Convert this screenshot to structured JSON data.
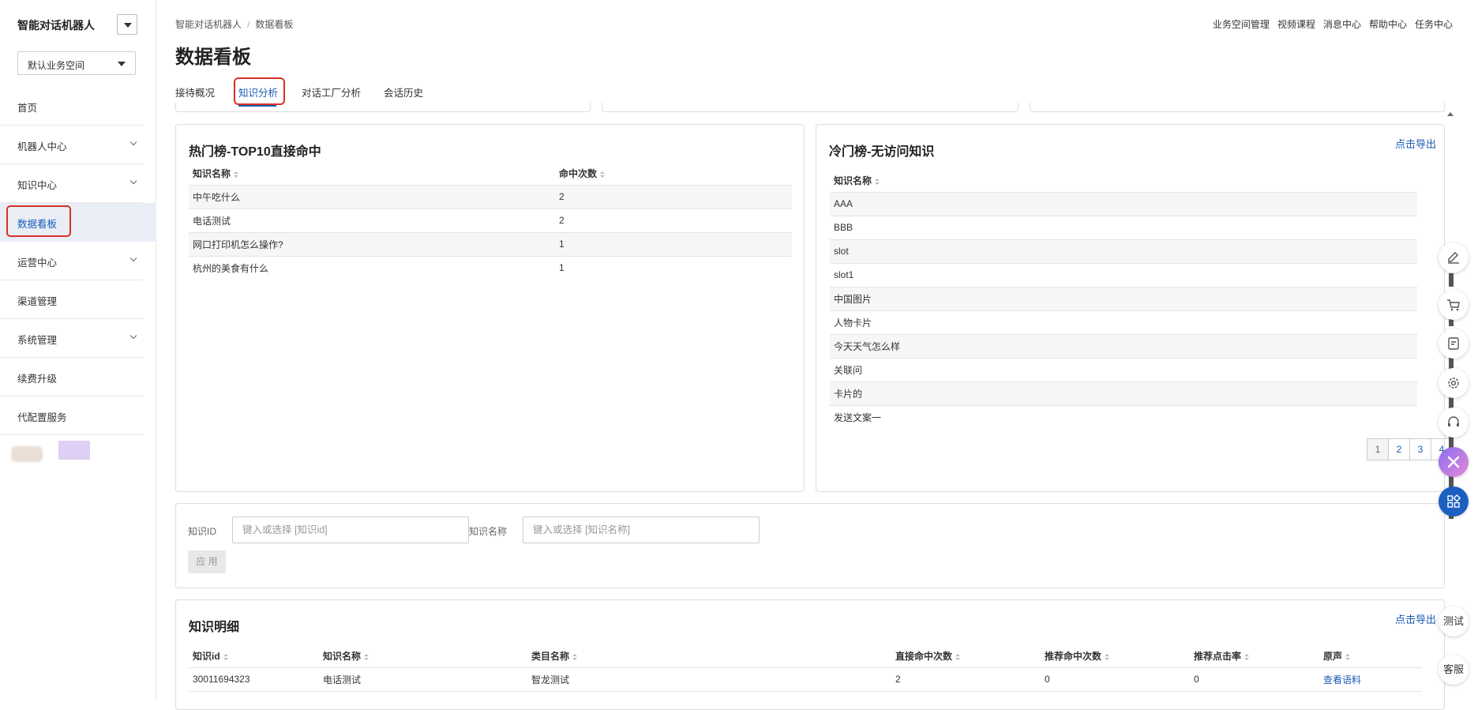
{
  "sidebar": {
    "brand": "智能对话机器人",
    "space_select": "默认业务空间",
    "items": [
      {
        "label": "首页",
        "has_chevron": false
      },
      {
        "label": "机器人中心",
        "has_chevron": true
      },
      {
        "label": "知识中心",
        "has_chevron": true
      },
      {
        "label": "数据看板",
        "has_chevron": false,
        "active": true
      },
      {
        "label": "运营中心",
        "has_chevron": true
      },
      {
        "label": "渠道管理",
        "has_chevron": false
      },
      {
        "label": "系统管理",
        "has_chevron": true
      },
      {
        "label": "续费升级",
        "has_chevron": false
      },
      {
        "label": "代配置服务",
        "has_chevron": false
      }
    ]
  },
  "header": {
    "breadcrumb": [
      "智能对话机器人",
      "数据看板"
    ],
    "breadcrumb_sep": "/",
    "links": [
      "业务空间管理",
      "视频课程",
      "消息中心",
      "帮助中心",
      "任务中心"
    ],
    "title": "数据看板",
    "tabs": [
      "接待概况",
      "知识分析",
      "对话工厂分析",
      "会话历史"
    ],
    "active_tab": "知识分析"
  },
  "hot": {
    "title": "热门榜-TOP10直接命中",
    "columns": [
      "知识名称",
      "命中次数"
    ],
    "rows": [
      [
        "中午吃什么",
        "2"
      ],
      [
        "电话测试",
        "2"
      ],
      [
        "网口打印机怎么操作?",
        "1"
      ],
      [
        "杭州的美食有什么",
        "1"
      ]
    ]
  },
  "cold": {
    "title": "冷门榜-无访问知识",
    "export": "点击导出",
    "column": "知识名称",
    "rows": [
      "AAA",
      "BBB",
      "slot",
      "slot1",
      "中国图片",
      "人物卡片",
      "今天天气怎么样",
      "关联问",
      "卡片的",
      "发送文案一"
    ],
    "pages": [
      "1",
      "2",
      "3",
      "4"
    ],
    "current_page": "1"
  },
  "filter": {
    "id_label": "知识ID",
    "id_placeholder": "键入或选择 [知识id]",
    "name_label": "知识名称",
    "name_placeholder": "键入或选择 [知识名称]",
    "apply": "应 用"
  },
  "detail": {
    "title": "知识明细",
    "export": "点击导出",
    "columns": [
      "知识id",
      "知识名称",
      "类目名称",
      "直接命中次数",
      "推荐命中次数",
      "推荐点击率",
      "原声"
    ],
    "rows": [
      [
        "30011694323",
        "电话测试",
        "智龙测试",
        "2",
        "0",
        "0",
        "查看语料"
      ]
    ]
  },
  "floating": {
    "icons": [
      "edit-icon",
      "cart-icon",
      "api-icon",
      "settings-icon",
      "headset-icon",
      "close-icon",
      "apps-icon"
    ],
    "test_label": "测试",
    "service_label": "客服"
  }
}
